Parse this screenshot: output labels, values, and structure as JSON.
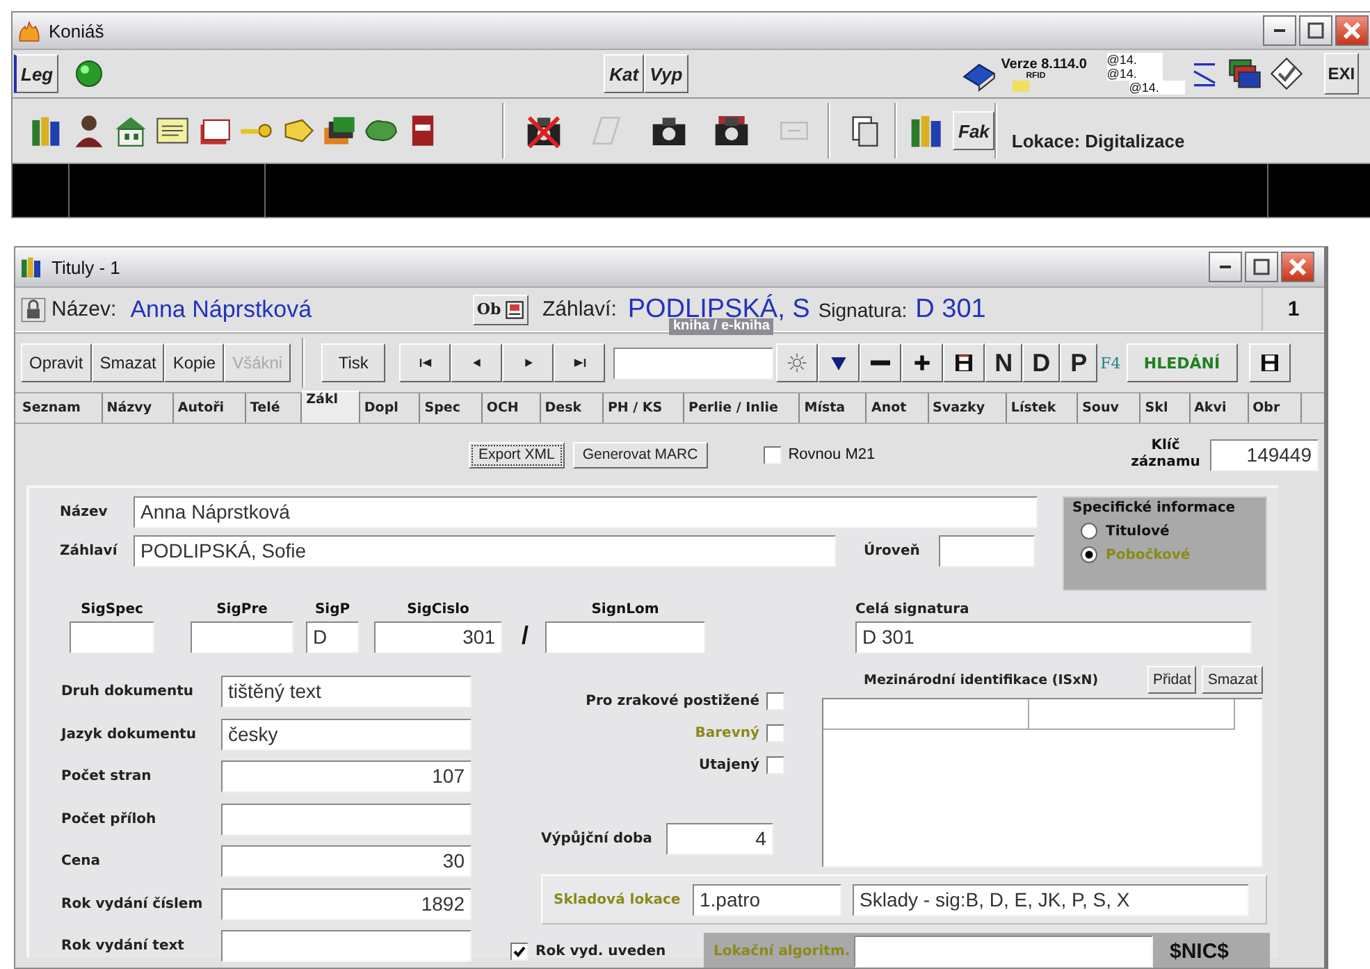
{
  "app_window": {
    "title": "Koniáš",
    "toolbar_top": {
      "leg_button": "Leg",
      "kat_button": "Kat",
      "vyp_button": "Vyp",
      "version": "Verze 8.114.0",
      "rfid": "RFID",
      "counters": [
        "@14.",
        "@14.",
        "@14."
      ],
      "exit_button": "EXI"
    },
    "toolbar_bottom": {
      "fak_button": "Fak",
      "location": "Lokace: Digitalizace"
    }
  },
  "record_window": {
    "title": "Tituly - 1",
    "header": {
      "title_label": "Název:",
      "title_value": "Anna Náprstková",
      "ob_button": "Ob",
      "heading_label": "Záhlaví:",
      "heading_value": "PODLIPSKÁ, S",
      "signature_label": "Signatura:",
      "signature_value": "D 301",
      "overlay": "kniha / e-kniha",
      "count": "1"
    },
    "actions": [
      {
        "label": "Opravit",
        "disabled": false
      },
      {
        "label": "Smazat",
        "disabled": false
      },
      {
        "label": "Kopie",
        "disabled": false
      },
      {
        "label": "Všákni",
        "disabled": true
      }
    ],
    "print_button": "Tisk",
    "tool_letters": [
      "N",
      "D",
      "P"
    ],
    "hotkey": "F4",
    "search_button": "HLEDÁNÍ",
    "tabs": [
      {
        "label": "Seznam",
        "selected": false
      },
      {
        "label": "Názvy",
        "selected": false
      },
      {
        "label": "Autoři",
        "selected": false
      },
      {
        "label": "Telé",
        "selected": false
      },
      {
        "label": "Zákl",
        "selected": true
      },
      {
        "label": "Dopl",
        "selected": false
      },
      {
        "label": "Spec",
        "selected": false
      },
      {
        "label": "OCH",
        "selected": false
      },
      {
        "label": "Desk",
        "selected": false
      },
      {
        "label": "PH / KS",
        "selected": false
      },
      {
        "label": "Perlie / Inlie",
        "selected": false
      },
      {
        "label": "Místa",
        "selected": false
      },
      {
        "label": "Anot",
        "selected": false
      },
      {
        "label": "Svazky",
        "selected": false
      },
      {
        "label": "Lístek",
        "selected": false
      },
      {
        "label": "Souv",
        "selected": false
      },
      {
        "label": "Skl",
        "selected": false
      },
      {
        "label": "Akvi",
        "selected": false
      },
      {
        "label": "Obr",
        "selected": false
      }
    ],
    "export_buttons": [
      "Export XML",
      "Generovat MARC"
    ],
    "export_option": {
      "label": "Rovnou M21",
      "checked": false
    },
    "record_key": {
      "label": "Klíč záznamu",
      "value": "149449"
    },
    "title_field": {
      "label": "Název",
      "value": "Anna Náprstková"
    },
    "heading_field": {
      "label": "Záhlaví",
      "value": "PODLIPSKÁ, Sofie"
    },
    "level_field": {
      "label": "Úroveň"
    },
    "specific_info": {
      "title": "Specifické informace",
      "options": [
        {
          "label": "Titulové",
          "selected": false
        },
        {
          "label": "Pobočkové",
          "selected": true
        }
      ]
    },
    "signature_parts": [
      {
        "label": "SigSpec"
      },
      {
        "label": "SigPre"
      },
      {
        "label": "SigP",
        "value": "D"
      },
      {
        "label": "SigCislo",
        "value": "301"
      },
      {
        "label": "SignLom"
      }
    ],
    "signature_separator": "/",
    "full_signature": {
      "label": "Celá signatura",
      "value": "D 301"
    },
    "document_fields": [
      {
        "label": "Druh dokumentu",
        "value": "tištěný text",
        "kind": "text"
      },
      {
        "label": "Jazyk dokumentu",
        "value": "česky",
        "kind": "text"
      },
      {
        "label": "Počet stran",
        "value": "107",
        "kind": "number"
      },
      {
        "label": "Počet příloh",
        "kind": "number"
      },
      {
        "label": "Cena",
        "value": "30",
        "kind": "number"
      },
      {
        "label": "Rok vydání číslem",
        "value": "1892",
        "kind": "number"
      },
      {
        "label": "Rok vydání text",
        "kind": "text"
      }
    ],
    "flags": [
      {
        "label": "Pro zrakové postižené",
        "checked": false,
        "highlighted": false
      },
      {
        "label": "Barevný",
        "checked": false,
        "highlighted": true
      },
      {
        "label": "Utajený",
        "checked": false,
        "highlighted": false
      }
    ],
    "loan_period": {
      "label": "Výpůjční doba",
      "value": "4"
    },
    "identifiers": {
      "label": "Mezinárodní identifikace (ISxN)",
      "buttons": [
        "Přidat",
        "Smazat"
      ]
    },
    "storage": {
      "label": "Skladová lokace",
      "value": "1.patro",
      "description": "Sklady - sig:B, D, E, JK, P, S, X"
    },
    "year_flag": {
      "label": "Rok vyd. uveden",
      "checked": true
    },
    "location_algorithm": {
      "label": "Lokační algoritm.",
      "code": "$NIC$"
    }
  }
}
